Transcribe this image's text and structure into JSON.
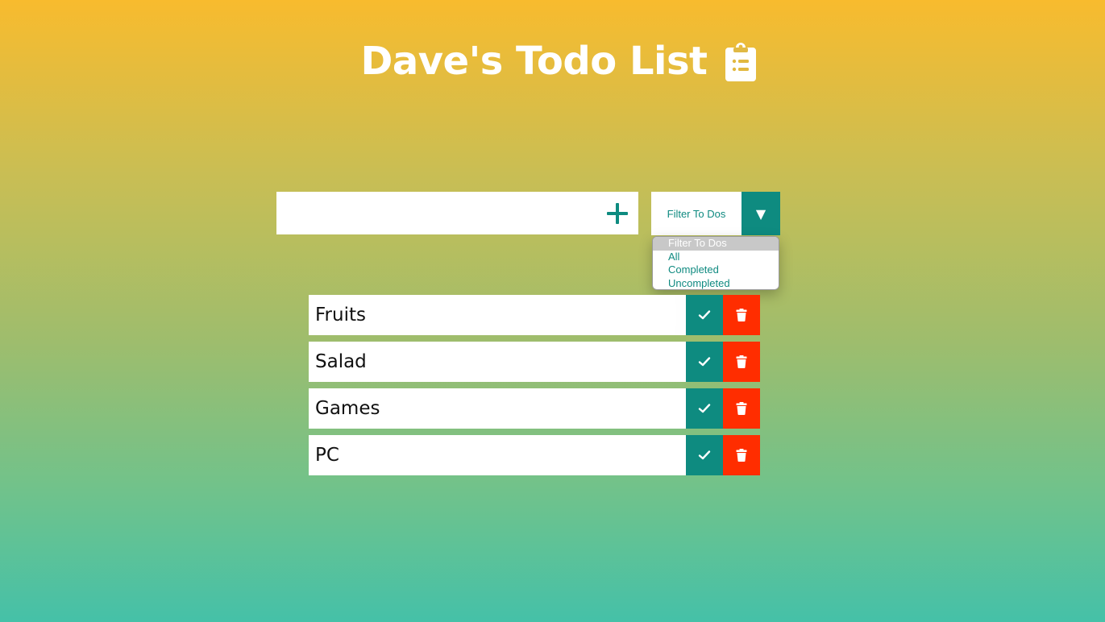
{
  "header": {
    "title": "Dave's Todo List",
    "icon": "clipboard-list-icon"
  },
  "todo_input": {
    "value": "",
    "placeholder": "",
    "add_icon": "plus-icon"
  },
  "filter": {
    "selected": "Filter To Dos",
    "arrow": "▼",
    "options": [
      "Filter To Dos",
      "All",
      "Completed",
      "Uncompleted"
    ],
    "highlighted_option": "Filter To Dos"
  },
  "todos": [
    {
      "text": "Fruits",
      "complete_icon": "check-icon",
      "delete_icon": "trash-icon"
    },
    {
      "text": "Salad",
      "complete_icon": "check-icon",
      "delete_icon": "trash-icon"
    },
    {
      "text": "Games",
      "complete_icon": "check-icon",
      "delete_icon": "trash-icon"
    },
    {
      "text": "PC",
      "complete_icon": "check-icon",
      "delete_icon": "trash-icon"
    }
  ],
  "colors": {
    "accent": "#0e8b80",
    "delete": "#ff2d00",
    "gradient_top": "#f8bb2e",
    "gradient_bottom": "#45c1a8"
  }
}
